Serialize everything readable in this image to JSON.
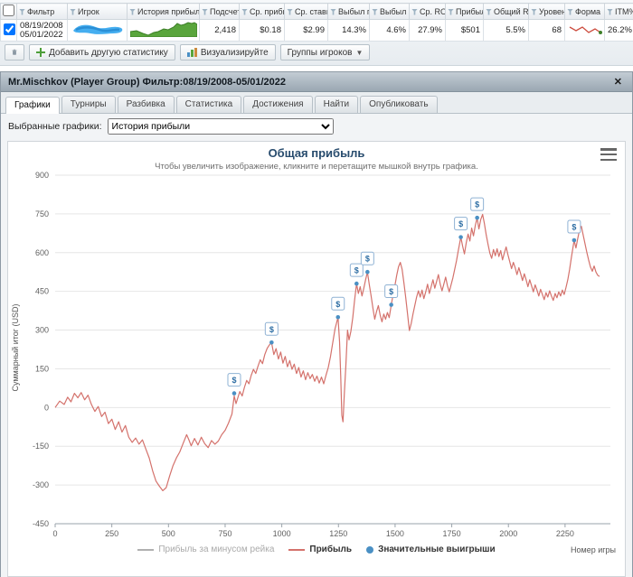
{
  "table": {
    "columns": [
      "Фильтр",
      "Игрок",
      "История прибыли",
      "Подсчет",
      "Ср. прибыль",
      "Ср. ставка",
      "Выбыл поз",
      "Выбыл ран",
      "Ср. ROI",
      "Прибыль",
      "Общий ROI",
      "Уровень",
      "Форма",
      "ITM%"
    ],
    "row": {
      "filter_from": "08/19/2008",
      "filter_to": "05/01/2022",
      "count": "2,418",
      "avg_profit": "$0.18",
      "avg_stake": "$2.99",
      "busted_late": "14.3%",
      "busted_early": "4.6%",
      "avg_roi": "27.9%",
      "profit": "$501",
      "total_roi": "5.5%",
      "level": "68",
      "itm": "26.2%"
    }
  },
  "toolbar": {
    "add_stat": "Добавить другую статистику",
    "visualize": "Визуализируйте",
    "player_groups": "Группы игроков"
  },
  "panel": {
    "title": "Mr.Mischkov (Player Group) Фильтр:08/19/2008-05/01/2022",
    "close": "✕",
    "tabs": [
      "Графики",
      "Турниры",
      "Разбивка",
      "Статистика",
      "Достижения",
      "Найти",
      "Опубликовать"
    ],
    "selected_graphs_label": "Выбранные графики:",
    "graph_select_value": "История прибыли"
  },
  "colors": {
    "profit_line": "#d4726c",
    "rake_line": "#b0b0b0",
    "marker_blue": "#4a90c4",
    "grid": "#e6e6e6"
  },
  "chart_data": {
    "type": "line",
    "title": "Общая прибыль",
    "subtitle": "Чтобы увеличить изображение, кликните и перетащите мышкой внутрь графика.",
    "ylabel": "Суммарный итог (USD)",
    "xlabel": "Номер игры",
    "ylim": [
      -450,
      900
    ],
    "xlim": [
      0,
      2450
    ],
    "yticks": [
      900,
      750,
      600,
      450,
      300,
      150,
      0,
      -150,
      -300,
      -450
    ],
    "xticks": [
      0,
      250,
      500,
      750,
      1000,
      1250,
      1500,
      1750,
      2000,
      2250
    ],
    "grid": "horizontal",
    "legend": [
      {
        "label": "Прибыль за минусом рейка",
        "color": "#b0b0b0",
        "type": "line",
        "muted": true
      },
      {
        "label": "Прибыль",
        "color": "#d4726c",
        "type": "line",
        "muted": false
      },
      {
        "label": "Значительные выигрыши",
        "color": "#4a90c4",
        "type": "marker",
        "muted": false
      }
    ],
    "series": [
      {
        "name": "Прибыль",
        "color": "#d4726c",
        "points": [
          [
            0,
            0
          ],
          [
            20,
            25
          ],
          [
            40,
            12
          ],
          [
            55,
            40
          ],
          [
            70,
            22
          ],
          [
            85,
            55
          ],
          [
            100,
            38
          ],
          [
            115,
            58
          ],
          [
            130,
            30
          ],
          [
            145,
            48
          ],
          [
            160,
            12
          ],
          [
            175,
            -15
          ],
          [
            190,
            4
          ],
          [
            205,
            -35
          ],
          [
            220,
            -18
          ],
          [
            235,
            -62
          ],
          [
            250,
            -45
          ],
          [
            265,
            -85
          ],
          [
            280,
            -55
          ],
          [
            295,
            -95
          ],
          [
            310,
            -70
          ],
          [
            325,
            -115
          ],
          [
            340,
            -135
          ],
          [
            355,
            -118
          ],
          [
            370,
            -142
          ],
          [
            385,
            -125
          ],
          [
            400,
            -160
          ],
          [
            415,
            -195
          ],
          [
            430,
            -245
          ],
          [
            445,
            -285
          ],
          [
            460,
            -305
          ],
          [
            475,
            -322
          ],
          [
            490,
            -310
          ],
          [
            505,
            -265
          ],
          [
            520,
            -225
          ],
          [
            535,
            -195
          ],
          [
            550,
            -172
          ],
          [
            565,
            -138
          ],
          [
            580,
            -105
          ],
          [
            590,
            -125
          ],
          [
            600,
            -148
          ],
          [
            615,
            -120
          ],
          [
            630,
            -145
          ],
          [
            645,
            -115
          ],
          [
            660,
            -140
          ],
          [
            675,
            -155
          ],
          [
            690,
            -128
          ],
          [
            705,
            -142
          ],
          [
            720,
            -130
          ],
          [
            735,
            -105
          ],
          [
            750,
            -88
          ],
          [
            765,
            -60
          ],
          [
            780,
            -25
          ],
          [
            790,
            45
          ],
          [
            798,
            15
          ],
          [
            806,
            38
          ],
          [
            815,
            62
          ],
          [
            825,
            45
          ],
          [
            835,
            78
          ],
          [
            845,
            105
          ],
          [
            855,
            92
          ],
          [
            865,
            125
          ],
          [
            875,
            148
          ],
          [
            885,
            132
          ],
          [
            895,
            160
          ],
          [
            905,
            185
          ],
          [
            915,
            170
          ],
          [
            925,
            205
          ],
          [
            935,
            228
          ],
          [
            945,
            242
          ],
          [
            955,
            252
          ],
          [
            965,
            205
          ],
          [
            975,
            228
          ],
          [
            985,
            188
          ],
          [
            995,
            215
          ],
          [
            1005,
            172
          ],
          [
            1015,
            198
          ],
          [
            1025,
            158
          ],
          [
            1035,
            182
          ],
          [
            1045,
            148
          ],
          [
            1055,
            168
          ],
          [
            1065,
            132
          ],
          [
            1075,
            155
          ],
          [
            1085,
            118
          ],
          [
            1095,
            142
          ],
          [
            1105,
            108
          ],
          [
            1115,
            135
          ],
          [
            1125,
            112
          ],
          [
            1135,
            128
          ],
          [
            1145,
            102
          ],
          [
            1155,
            122
          ],
          [
            1165,
            95
          ],
          [
            1175,
            118
          ],
          [
            1185,
            92
          ],
          [
            1195,
            125
          ],
          [
            1205,
            155
          ],
          [
            1215,
            198
          ],
          [
            1225,
            252
          ],
          [
            1235,
            305
          ],
          [
            1248,
            350
          ],
          [
            1255,
            255
          ],
          [
            1260,
            120
          ],
          [
            1265,
            -30
          ],
          [
            1270,
            -55
          ],
          [
            1276,
            55
          ],
          [
            1283,
            165
          ],
          [
            1290,
            300
          ],
          [
            1297,
            262
          ],
          [
            1305,
            295
          ],
          [
            1313,
            348
          ],
          [
            1321,
            415
          ],
          [
            1330,
            480
          ],
          [
            1338,
            442
          ],
          [
            1346,
            468
          ],
          [
            1354,
            432
          ],
          [
            1362,
            462
          ],
          [
            1370,
            495
          ],
          [
            1378,
            525
          ],
          [
            1386,
            478
          ],
          [
            1394,
            432
          ],
          [
            1402,
            385
          ],
          [
            1410,
            342
          ],
          [
            1418,
            372
          ],
          [
            1426,
            395
          ],
          [
            1434,
            358
          ],
          [
            1442,
            332
          ],
          [
            1450,
            362
          ],
          [
            1458,
            342
          ],
          [
            1466,
            368
          ],
          [
            1474,
            348
          ],
          [
            1483,
            398
          ],
          [
            1491,
            438
          ],
          [
            1499,
            472
          ],
          [
            1507,
            512
          ],
          [
            1515,
            545
          ],
          [
            1523,
            562
          ],
          [
            1531,
            535
          ],
          [
            1539,
            482
          ],
          [
            1547,
            425
          ],
          [
            1555,
            362
          ],
          [
            1563,
            298
          ],
          [
            1571,
            325
          ],
          [
            1579,
            362
          ],
          [
            1587,
            395
          ],
          [
            1595,
            428
          ],
          [
            1603,
            452
          ],
          [
            1611,
            428
          ],
          [
            1619,
            455
          ],
          [
            1627,
            422
          ],
          [
            1635,
            448
          ],
          [
            1643,
            478
          ],
          [
            1651,
            442
          ],
          [
            1659,
            468
          ],
          [
            1667,
            495
          ],
          [
            1675,
            462
          ],
          [
            1683,
            488
          ],
          [
            1691,
            515
          ],
          [
            1699,
            478
          ],
          [
            1707,
            452
          ],
          [
            1715,
            478
          ],
          [
            1723,
            505
          ],
          [
            1731,
            472
          ],
          [
            1739,
            448
          ],
          [
            1747,
            475
          ],
          [
            1755,
            502
          ],
          [
            1763,
            535
          ],
          [
            1771,
            568
          ],
          [
            1779,
            608
          ],
          [
            1790,
            660
          ],
          [
            1798,
            625
          ],
          [
            1806,
            595
          ],
          [
            1814,
            638
          ],
          [
            1822,
            672
          ],
          [
            1830,
            645
          ],
          [
            1838,
            695
          ],
          [
            1846,
            665
          ],
          [
            1854,
            705
          ],
          [
            1862,
            735
          ],
          [
            1870,
            692
          ],
          [
            1878,
            728
          ],
          [
            1886,
            748
          ],
          [
            1894,
            712
          ],
          [
            1902,
            668
          ],
          [
            1910,
            632
          ],
          [
            1918,
            598
          ],
          [
            1926,
            578
          ],
          [
            1934,
            612
          ],
          [
            1942,
            588
          ],
          [
            1950,
            615
          ],
          [
            1958,
            585
          ],
          [
            1966,
            608
          ],
          [
            1974,
            572
          ],
          [
            1982,
            598
          ],
          [
            1990,
            622
          ],
          [
            1998,
            592
          ],
          [
            2006,
            565
          ],
          [
            2014,
            538
          ],
          [
            2022,
            562
          ],
          [
            2030,
            542
          ],
          [
            2038,
            515
          ],
          [
            2046,
            542
          ],
          [
            2054,
            518
          ],
          [
            2062,
            492
          ],
          [
            2070,
            518
          ],
          [
            2078,
            495
          ],
          [
            2086,
            468
          ],
          [
            2094,
            495
          ],
          [
            2102,
            472
          ],
          [
            2110,
            448
          ],
          [
            2118,
            475
          ],
          [
            2126,
            455
          ],
          [
            2134,
            432
          ],
          [
            2142,
            458
          ],
          [
            2150,
            438
          ],
          [
            2158,
            418
          ],
          [
            2166,
            445
          ],
          [
            2174,
            428
          ],
          [
            2182,
            452
          ],
          [
            2190,
            432
          ],
          [
            2198,
            415
          ],
          [
            2206,
            442
          ],
          [
            2214,
            425
          ],
          [
            2222,
            448
          ],
          [
            2230,
            432
          ],
          [
            2238,
            455
          ],
          [
            2246,
            438
          ],
          [
            2254,
            465
          ],
          [
            2262,
            495
          ],
          [
            2270,
            535
          ],
          [
            2278,
            582
          ],
          [
            2290,
            648
          ],
          [
            2298,
            618
          ],
          [
            2306,
            655
          ],
          [
            2314,
            688
          ],
          [
            2322,
            702
          ],
          [
            2330,
            668
          ],
          [
            2338,
            635
          ],
          [
            2346,
            602
          ],
          [
            2354,
            572
          ],
          [
            2362,
            545
          ],
          [
            2370,
            528
          ],
          [
            2378,
            548
          ],
          [
            2386,
            525
          ],
          [
            2394,
            512
          ],
          [
            2402,
            508
          ]
        ]
      }
    ],
    "markers": {
      "name": "Значительные выигрыши",
      "symbol": "$",
      "points": [
        [
          790,
          55
        ],
        [
          955,
          252
        ],
        [
          1248,
          350
        ],
        [
          1330,
          480
        ],
        [
          1378,
          525
        ],
        [
          1483,
          398
        ],
        [
          1790,
          660
        ],
        [
          1862,
          735
        ],
        [
          2290,
          648
        ]
      ]
    }
  }
}
